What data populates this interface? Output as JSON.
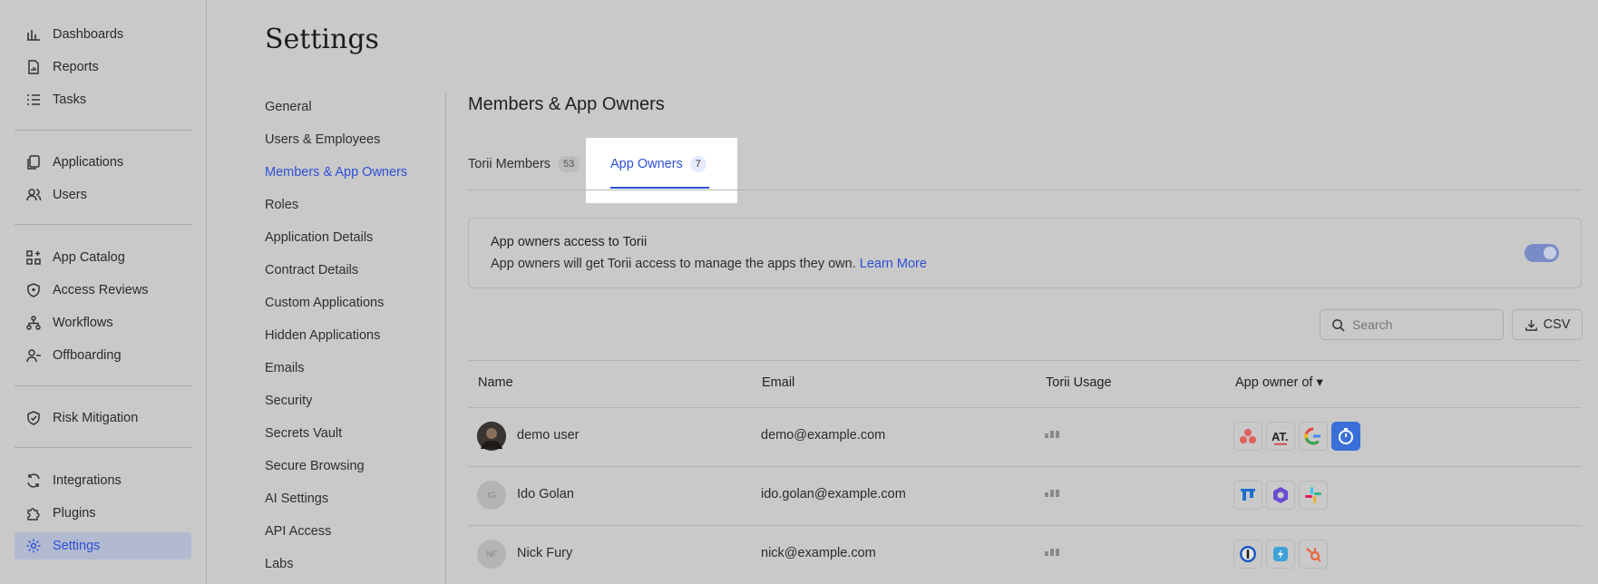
{
  "sidebar": {
    "items": [
      {
        "label": "Dashboards",
        "icon": "chart-bar-icon"
      },
      {
        "label": "Reports",
        "icon": "report-icon"
      },
      {
        "label": "Tasks",
        "icon": "tasks-icon"
      },
      {
        "label": "Applications",
        "icon": "applications-icon"
      },
      {
        "label": "Users",
        "icon": "users-icon"
      },
      {
        "label": "App Catalog",
        "icon": "app-catalog-icon"
      },
      {
        "label": "Access Reviews",
        "icon": "shield-icon"
      },
      {
        "label": "Workflows",
        "icon": "workflow-icon"
      },
      {
        "label": "Offboarding",
        "icon": "user-minus-icon"
      },
      {
        "label": "Risk Mitigation",
        "icon": "shield-check-icon"
      },
      {
        "label": "Integrations",
        "icon": "sync-icon"
      },
      {
        "label": "Plugins",
        "icon": "puzzle-icon"
      },
      {
        "label": "Settings",
        "icon": "gear-icon"
      }
    ]
  },
  "page_title": "Settings",
  "settings_menu": [
    "General",
    "Users & Employees",
    "Members & App Owners",
    "Roles",
    "Application Details",
    "Contract Details",
    "Custom Applications",
    "Hidden Applications",
    "Emails",
    "Security",
    "Secrets Vault",
    "Secure Browsing",
    "AI Settings",
    "API Access",
    "Labs"
  ],
  "section_title": "Members & App Owners",
  "tabs": [
    {
      "label": "Torii Members",
      "count": "53"
    },
    {
      "label": "App Owners",
      "count": "7"
    }
  ],
  "access_card": {
    "title": "App owners access to Torii",
    "description": "App owners will get Torii access to manage the apps they own.",
    "link": "Learn More",
    "toggle_on": true
  },
  "search": {
    "placeholder": "Search"
  },
  "csv_label": "CSV",
  "table": {
    "headers": [
      "Name",
      "Email",
      "Torii Usage",
      "App owner of ▾"
    ],
    "rows": [
      {
        "initials": "",
        "name": "demo user",
        "email": "demo@example.com",
        "apps": [
          "asana-icon",
          "atlassian-icon",
          "google-icon",
          "timer-app-icon"
        ]
      },
      {
        "initials": "IG",
        "name": "Ido Golan",
        "email": "ido.golan@example.com",
        "apps": [
          "trello-icon",
          "teams-loop-icon",
          "slack-icon"
        ]
      },
      {
        "initials": "NF",
        "name": "Nick Fury",
        "email": "nick@example.com",
        "apps": [
          "1password-icon",
          "zendesk-icon",
          "hubspot-icon"
        ]
      }
    ]
  }
}
